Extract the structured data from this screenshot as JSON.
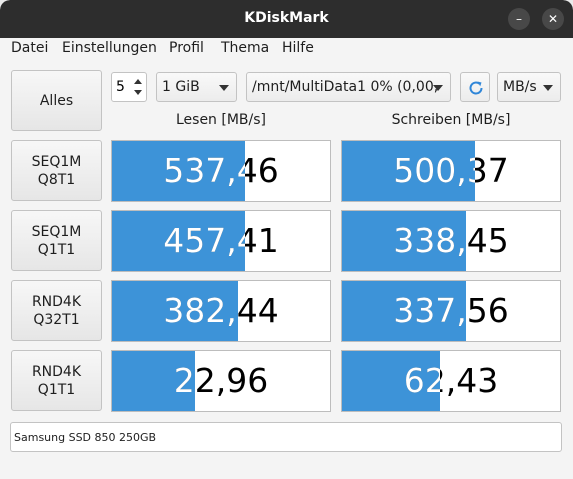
{
  "window": {
    "title": "KDiskMark",
    "minimize_glyph": "–",
    "close_glyph": "✕"
  },
  "menu": {
    "items": [
      "Datei",
      "Einstellungen",
      "Profil",
      "Thema",
      "Hilfe"
    ]
  },
  "toolbar": {
    "all_label": "Alles",
    "loops_value": "5",
    "size_value": "1 GiB",
    "target_value": "/mnt/MultiData1 0% (0,00,",
    "unit_value": "MB/s",
    "refresh_icon": "refresh-icon",
    "accent_color": "#2f86d8"
  },
  "columns": {
    "read_label": "Lesen [MB/s]",
    "write_label": "Schreiben [MB/s]"
  },
  "tests": [
    {
      "line1": "SEQ1M",
      "line2": "Q8T1",
      "read": "537,46",
      "read_fraction": 0.61,
      "write": "500,37",
      "write_fraction": 0.61
    },
    {
      "line1": "SEQ1M",
      "line2": "Q1T1",
      "read": "457,41",
      "read_fraction": 0.61,
      "write": "338,45",
      "write_fraction": 0.57
    },
    {
      "line1": "RND4K",
      "line2": "Q32T1",
      "read": "382,44",
      "read_fraction": 0.58,
      "write": "337,56",
      "write_fraction": 0.57
    },
    {
      "line1": "RND4K",
      "line2": "Q1T1",
      "read": "22,96",
      "read_fraction": 0.38,
      "write": "62,43",
      "write_fraction": 0.45
    }
  ],
  "bar_color": "#3d93d8",
  "status": {
    "device_label": "Samsung SSD 850 250GB"
  }
}
